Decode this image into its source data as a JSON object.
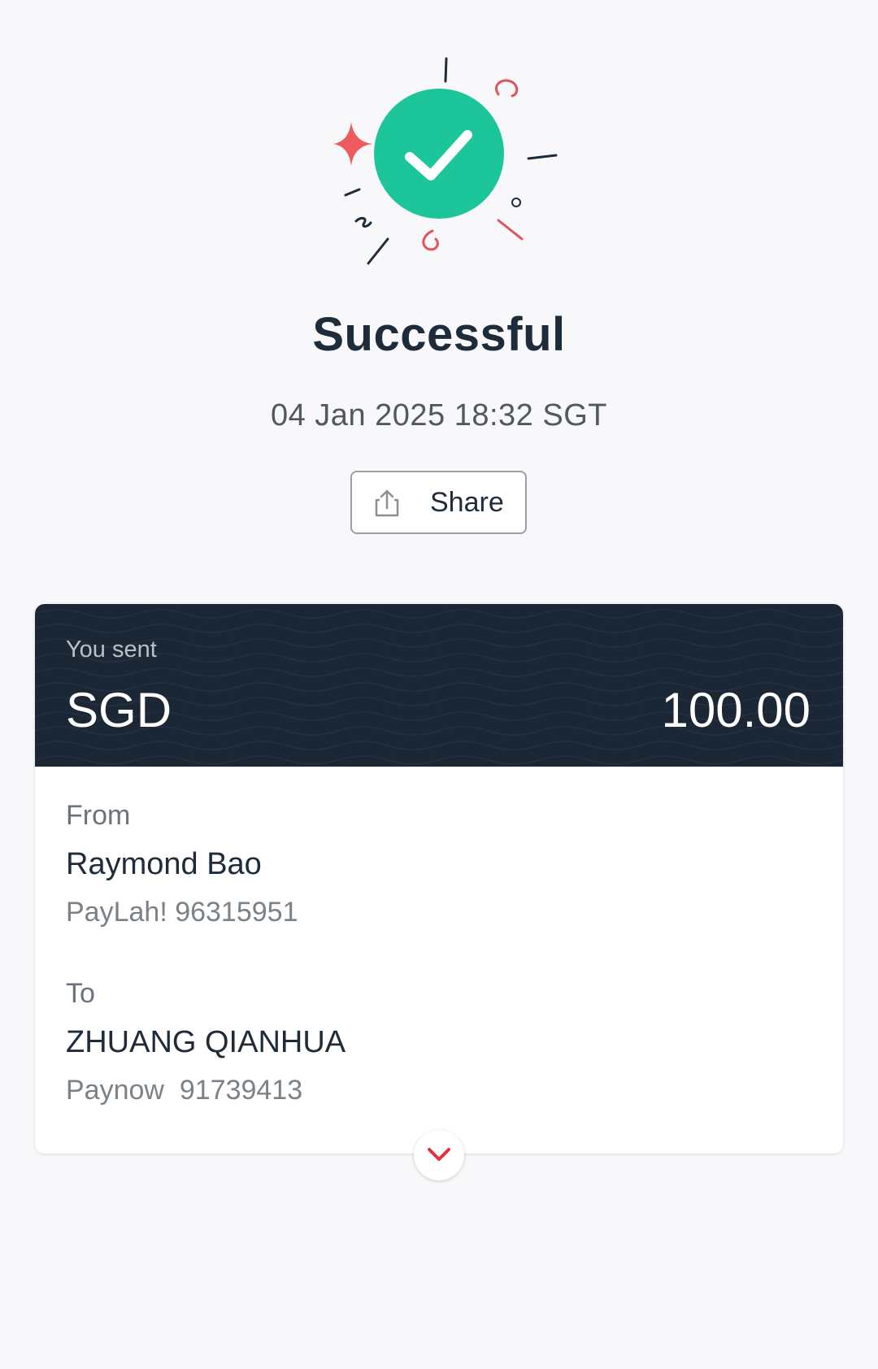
{
  "status": {
    "title": "Successful",
    "datetime": "04 Jan 2025 18:32 SGT",
    "icon": "check-circle-icon",
    "accent_color": "#1dc59a"
  },
  "share": {
    "label": "Share",
    "icon": "share-icon"
  },
  "transfer": {
    "sent_label": "You sent",
    "currency": "SGD",
    "amount": "100.00",
    "from": {
      "label": "From",
      "name": "Raymond Bao",
      "detail": "PayLah! 96315951"
    },
    "to": {
      "label": "To",
      "name": "ZHUANG QIANHUA",
      "detail": "Paynow  91739413"
    },
    "expand_icon": "chevron-down-icon",
    "expand_color": "#e2333a"
  }
}
